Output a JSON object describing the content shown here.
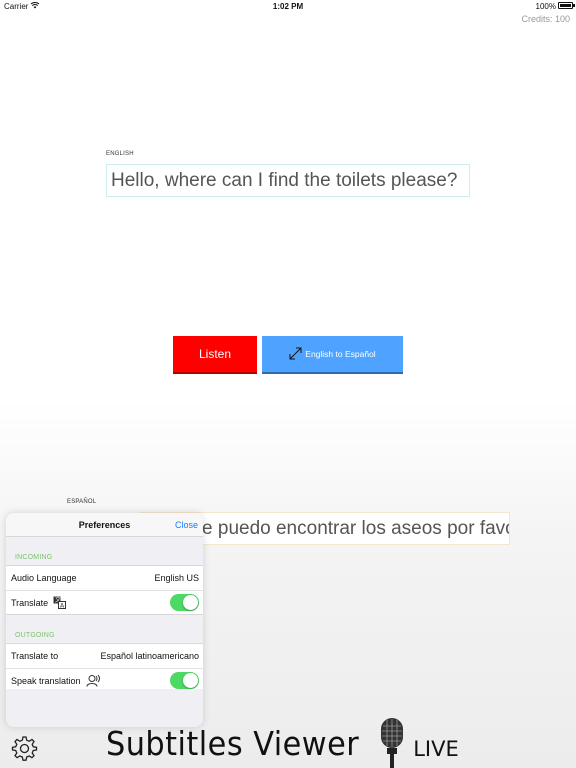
{
  "status_bar": {
    "carrier": "Carrier",
    "time": "1:02 PM",
    "battery": "100%"
  },
  "credits": "Credits: 100",
  "source": {
    "language_label": "ENGLISH",
    "text": "Hello, where can I find the toilets please?"
  },
  "target": {
    "language_label": "ESPAÑOL",
    "text": "¿Dónde puedo encontrar los aseos por favor?"
  },
  "buttons": {
    "listen": "Listen",
    "direction": "English to Español",
    "listen_color": "#ff0000",
    "direction_color": "#4da3ff"
  },
  "preferences": {
    "title": "Preferences",
    "close": "Close",
    "incoming": {
      "header": "INCOMING",
      "audio_language_label": "Audio Language",
      "audio_language_value": "English US",
      "translate_label": "Translate",
      "translate_on": true
    },
    "outgoing": {
      "header": "OUTGOING",
      "translate_to_label": "Translate to",
      "translate_to_value": "Español latinoamericano",
      "speak_label": "Speak translation",
      "speak_on": true
    }
  },
  "brand": {
    "name": "Subtitles Viewer",
    "suffix": "LIVE"
  },
  "icons": [
    "wifi-icon",
    "battery-icon",
    "expand-arrows-icon",
    "translate-icon",
    "speaker-person-icon",
    "gear-icon",
    "microphone-icon"
  ]
}
